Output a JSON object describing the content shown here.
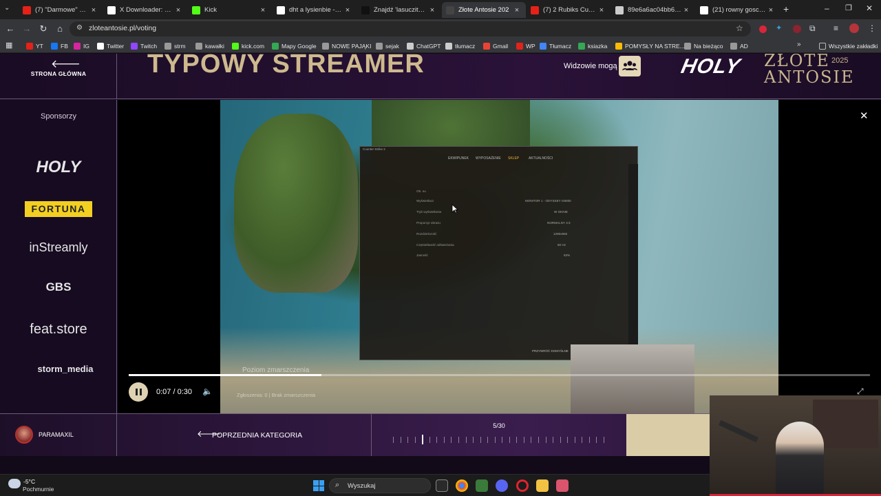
{
  "browser": {
    "tabs": [
      {
        "title": "(7) \"Darmowe\" domy",
        "favicon_color": "#e62117",
        "favicon": "youtube-icon"
      },
      {
        "title": "X Downloader: Free T",
        "favicon_color": "#ffffff",
        "favicon": "x-icon"
      },
      {
        "title": "Kick",
        "favicon_color": "#53fc18",
        "favicon": "kick-icon"
      },
      {
        "title": "dht a lysienbie - Szuk",
        "favicon_color": "#ffffff",
        "favicon": "google-icon"
      },
      {
        "title": "Znajdź 'lasuczita' na",
        "favicon_color": "#111111",
        "favicon": "tiktok-icon"
      },
      {
        "title": "Złote Antosie 202",
        "favicon_color": "#444444",
        "favicon": "page-icon",
        "active": true
      },
      {
        "title": "(7) 2 Rubiks Cubes 2",
        "favicon_color": "#e62117",
        "favicon": "youtube-icon"
      },
      {
        "title": "89e6a6ac04bb60a51",
        "favicon_color": "#cccccc",
        "favicon": "globe-icon"
      },
      {
        "title": "(21) rowny gosc w se",
        "favicon_color": "#ffffff",
        "favicon": "x-icon"
      }
    ],
    "url": "zloteantosie.pl/voting",
    "bookmarks": [
      {
        "label": "YT",
        "color": "#e62117"
      },
      {
        "label": "FB",
        "color": "#1877f2"
      },
      {
        "label": "IG",
        "color": "#d6249f"
      },
      {
        "label": "Twitter",
        "color": "#ffffff"
      },
      {
        "label": "Twitch",
        "color": "#9146ff"
      },
      {
        "label": "strm",
        "color": "#999999"
      },
      {
        "label": "kawałki",
        "color": "#999999"
      },
      {
        "label": "kick.com",
        "color": "#53fc18"
      },
      {
        "label": "Mapy Google",
        "color": "#34a853"
      },
      {
        "label": "NOWE PAJĄKI",
        "color": "#999999"
      },
      {
        "label": "sejak",
        "color": "#999999"
      },
      {
        "label": "ChatGPT",
        "color": "#cccccc"
      },
      {
        "label": "tłumacz",
        "color": "#cccccc"
      },
      {
        "label": "Gmail",
        "color": "#ea4335"
      },
      {
        "label": "WP",
        "color": "#e2231a"
      },
      {
        "label": "Tłumacz",
        "color": "#4285f4"
      },
      {
        "label": "ksiazka",
        "color": "#34a853"
      },
      {
        "label": "POMYSŁY NA STRE...",
        "color": "#fbbc05"
      },
      {
        "label": "Na bieżąco",
        "color": "#999999"
      },
      {
        "label": "AD",
        "color": "#999999"
      }
    ],
    "all_bookmarks": "Wszystkie zakładki"
  },
  "page": {
    "home_label": "STRONA GŁÓWNA",
    "category_title": "TYPOWY STREAMER",
    "viewers_label": "Widzowie mogą",
    "header_logo": "HOLY",
    "event_logo": "ZŁOTE ANTOSIE",
    "event_year": "2025",
    "sponsors_title": "Sponsorzy",
    "sponsors": [
      "HOLY",
      "FORTUNA",
      "inStreamly",
      "GBS",
      "feat.store",
      "storm_media"
    ],
    "video": {
      "time": "0:07 / 0:30",
      "progress": 0.26,
      "overlay_title": "Poziom zmarszczenia",
      "overlay_sub": "Zgłoszenia: 0 | Brak zmarszczenia",
      "game_tabs": [
        "EKWIPUNEK",
        "WYPOSAŻENIE",
        "SKLEP",
        "AKTUALNOŚCI"
      ],
      "settings_rows": [
        "Ob. ou",
        "Wyświetlacz",
        "Tryb wyświetlania",
        "Proporcje obrazu",
        "Rozdzielczość",
        "Częstotliwość odświeżania",
        "Jasność"
      ],
      "settings_values": [
        "MONITOR 1 - ODYSSEY G6000",
        "W OKNIE",
        "NORMALNY 4:3",
        "1280x960",
        "60 Hz",
        "63%"
      ],
      "restore_label": "PRZYWRÓĆ DOMYŚLNE"
    },
    "user_name": "PARAMAXIL",
    "prev_category": "POPRZEDNIA KATEGORIA",
    "counter": "5/30",
    "counter_total": 30,
    "counter_current": 5
  },
  "taskbar": {
    "temperature": "-5°C",
    "weather": "Pochmurnie",
    "search_placeholder": "Wyszukaj"
  }
}
